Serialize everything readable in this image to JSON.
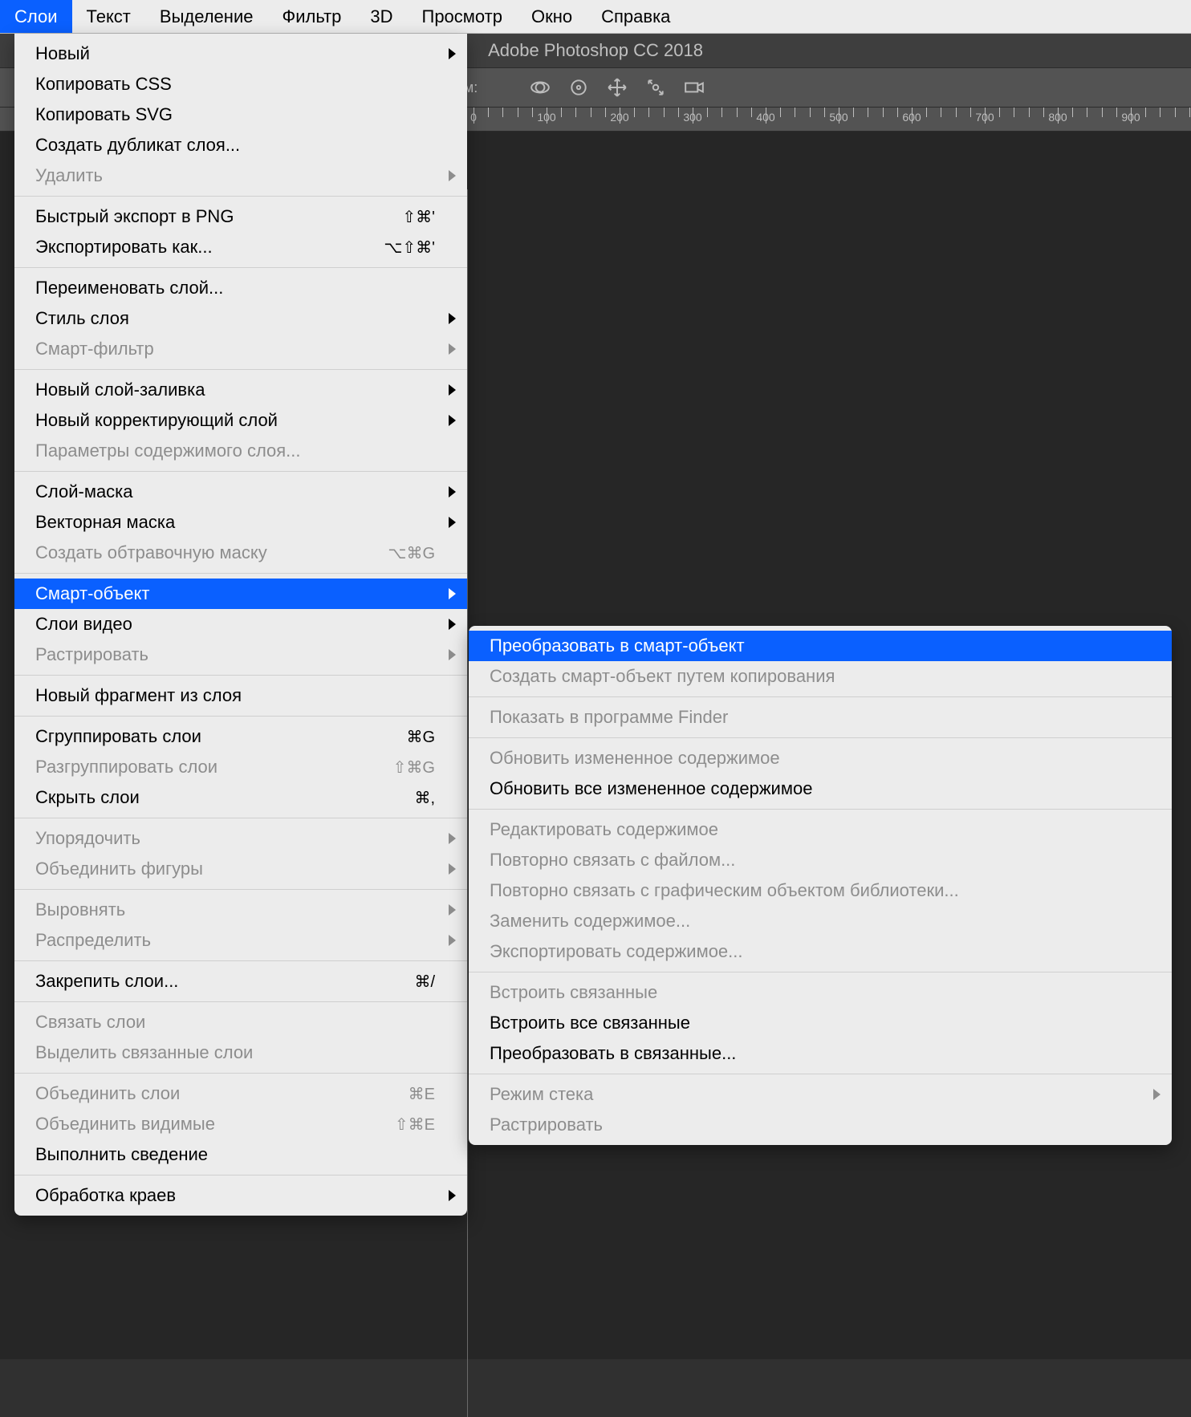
{
  "menubar": {
    "items": [
      "Слои",
      "Текст",
      "Выделение",
      "Фильтр",
      "3D",
      "Просмотр",
      "Окно",
      "Справка"
    ],
    "active_index": 0
  },
  "titlebar": {
    "app": "Adobe Photoshop CC 2018"
  },
  "optionsbar": {
    "mode_label": "ежим:"
  },
  "ruler": {
    "start": 0,
    "step": 100,
    "count": 11,
    "labels": [
      "0",
      "100",
      "200",
      "300",
      "400",
      "500",
      "600",
      "700",
      "800",
      "900",
      "100"
    ]
  },
  "layers_menu": {
    "groups": [
      [
        {
          "label": "Новый",
          "submenu": true
        },
        {
          "label": "Копировать CSS"
        },
        {
          "label": "Копировать SVG"
        },
        {
          "label": "Создать дубликат слоя..."
        },
        {
          "label": "Удалить",
          "submenu": true,
          "disabled": true
        }
      ],
      [
        {
          "label": "Быстрый экспорт в PNG",
          "shortcut": "⇧⌘'"
        },
        {
          "label": "Экспортировать как...",
          "shortcut": "⌥⇧⌘'"
        }
      ],
      [
        {
          "label": "Переименовать слой..."
        },
        {
          "label": "Стиль слоя",
          "submenu": true
        },
        {
          "label": "Смарт-фильтр",
          "submenu": true,
          "disabled": true
        }
      ],
      [
        {
          "label": "Новый слой-заливка",
          "submenu": true
        },
        {
          "label": "Новый корректирующий слой",
          "submenu": true
        },
        {
          "label": "Параметры содержимого слоя...",
          "disabled": true
        }
      ],
      [
        {
          "label": "Слой-маска",
          "submenu": true
        },
        {
          "label": "Векторная маска",
          "submenu": true
        },
        {
          "label": "Создать обтравочную маску",
          "shortcut": "⌥⌘G",
          "disabled": true
        }
      ],
      [
        {
          "label": "Смарт-объект",
          "submenu": true,
          "highlight": true
        },
        {
          "label": "Слои видео",
          "submenu": true
        },
        {
          "label": "Растрировать",
          "submenu": true,
          "disabled": true
        }
      ],
      [
        {
          "label": "Новый фрагмент из слоя"
        }
      ],
      [
        {
          "label": "Сгруппировать слои",
          "shortcut": "⌘G"
        },
        {
          "label": "Разгруппировать слои",
          "shortcut": "⇧⌘G",
          "disabled": true
        },
        {
          "label": "Скрыть слои",
          "shortcut": "⌘,"
        }
      ],
      [
        {
          "label": "Упорядочить",
          "submenu": true,
          "disabled": true
        },
        {
          "label": "Объединить фигуры",
          "submenu": true,
          "disabled": true
        }
      ],
      [
        {
          "label": "Выровнять",
          "submenu": true,
          "disabled": true
        },
        {
          "label": "Распределить",
          "submenu": true,
          "disabled": true
        }
      ],
      [
        {
          "label": "Закрепить слои...",
          "shortcut": "⌘/"
        }
      ],
      [
        {
          "label": "Связать слои",
          "disabled": true
        },
        {
          "label": "Выделить связанные слои",
          "disabled": true
        }
      ],
      [
        {
          "label": "Объединить слои",
          "shortcut": "⌘E",
          "disabled": true
        },
        {
          "label": "Объединить видимые",
          "shortcut": "⇧⌘E",
          "disabled": true
        },
        {
          "label": "Выполнить сведение"
        }
      ],
      [
        {
          "label": "Обработка краев",
          "submenu": true
        }
      ]
    ]
  },
  "smart_object_submenu": {
    "groups": [
      [
        {
          "label": "Преобразовать в смарт-объект",
          "highlight": true
        },
        {
          "label": "Создать смарт-объект путем копирования",
          "disabled": true
        }
      ],
      [
        {
          "label": "Показать в программе Finder",
          "disabled": true
        }
      ],
      [
        {
          "label": "Обновить измененное содержимое",
          "disabled": true
        },
        {
          "label": "Обновить все измененное содержимое"
        }
      ],
      [
        {
          "label": "Редактировать содержимое",
          "disabled": true
        },
        {
          "label": "Повторно связать с файлом...",
          "disabled": true
        },
        {
          "label": "Повторно связать с графическим объектом библиотеки...",
          "disabled": true
        },
        {
          "label": "Заменить содержимое...",
          "disabled": true
        },
        {
          "label": "Экспортировать содержимое...",
          "disabled": true
        }
      ],
      [
        {
          "label": "Встроить связанные",
          "disabled": true
        },
        {
          "label": "Встроить все связанные"
        },
        {
          "label": "Преобразовать в связанные..."
        }
      ],
      [
        {
          "label": "Режим стека",
          "submenu": true,
          "disabled": true
        },
        {
          "label": "Растрировать",
          "disabled": true
        }
      ]
    ]
  }
}
